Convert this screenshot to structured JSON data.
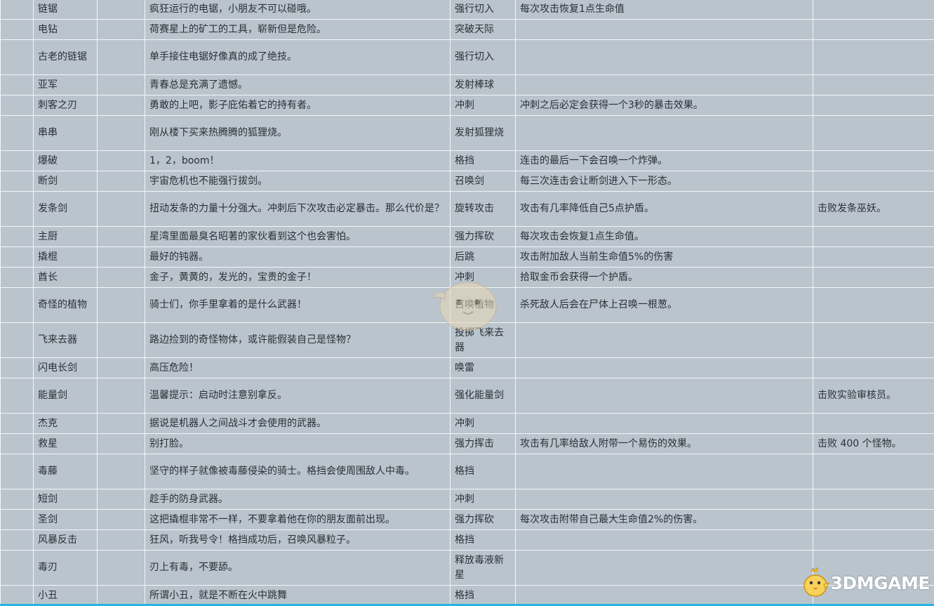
{
  "rows": [
    {
      "name": "链锯",
      "desc": "疯狂运行的电锯，小朋友不可以碰哦。",
      "skill": "强行切入",
      "effect": "每次攻击恢复1点生命值",
      "unlock": ""
    },
    {
      "name": "电钻",
      "desc": "荷赛星上的矿工的工具，崭新但是危险。",
      "skill": "突破天际",
      "effect": "",
      "unlock": ""
    },
    {
      "name": "古老的链锯",
      "desc": "单手接住电锯好像真的成了绝技。",
      "skill": "强行切入",
      "effect": "",
      "unlock": ""
    },
    {
      "name": "亚军",
      "desc": "青春总是充满了遗憾。",
      "skill": "发射棒球",
      "effect": "",
      "unlock": ""
    },
    {
      "name": "刺客之刃",
      "desc": "勇敢的上吧，影子庇佑着它的持有者。",
      "skill": "冲刺",
      "effect": "冲刺之后必定会获得一个3秒的暴击效果。",
      "unlock": ""
    },
    {
      "name": "串串",
      "desc": "刚从楼下买来热腾腾的狐狸烧。",
      "skill": "发射狐狸烧",
      "effect": "",
      "unlock": ""
    },
    {
      "name": "爆破",
      "desc": "1，2，boom！",
      "skill": "格挡",
      "effect": "连击的最后一下会召唤一个炸弹。",
      "unlock": ""
    },
    {
      "name": "断剑",
      "desc": "宇宙危机也不能强行拔剑。",
      "skill": "召唤剑",
      "effect": "每三次连击会让断剑进入下一形态。",
      "unlock": ""
    },
    {
      "name": "发条剑",
      "desc": "扭动发条的力量十分强大。冲刺后下次攻击必定暴击。那么代价是？",
      "skill": "旋转攻击",
      "effect": "攻击有几率降低自己5点护盾。",
      "unlock": "击败发条巫妖。"
    },
    {
      "name": "主厨",
      "desc": "星湾里面最臭名昭著的家伙看到这个也会害怕。",
      "skill": "强力挥砍",
      "effect": "每次攻击会恢复1点生命值。",
      "unlock": ""
    },
    {
      "name": "撬棍",
      "desc": "最好的钝器。",
      "skill": "后跳",
      "effect": "攻击附加敌人当前生命值5%的伤害",
      "unlock": ""
    },
    {
      "name": "酋长",
      "desc": "金子，黄黄的，发光的，宝贵的金子！",
      "skill": "冲刺",
      "effect": "拾取金币会获得一个护盾。",
      "unlock": ""
    },
    {
      "name": "奇怪的植物",
      "desc": "骑士们，你手里拿着的是什么武器！",
      "skill": "召唤植物",
      "effect": "杀死敌人后会在尸体上召唤一根葱。",
      "unlock": ""
    },
    {
      "name": "飞来去器",
      "desc": "路边捡到的奇怪物体，或许能假装自己是怪物？",
      "skill": "投掷飞来去器",
      "effect": "",
      "unlock": ""
    },
    {
      "name": "闪电长剑",
      "desc": "高压危险！",
      "skill": "唤雷",
      "effect": "",
      "unlock": ""
    },
    {
      "name": "能量剑",
      "desc": "温馨提示：启动时注意别拿反。",
      "skill": "强化能量剑",
      "effect": "",
      "unlock": "击败实验审核员。"
    },
    {
      "name": "杰克",
      "desc": "据说是机器人之间战斗才会使用的武器。",
      "skill": "冲刺",
      "effect": "",
      "unlock": ""
    },
    {
      "name": "救星",
      "desc": "别打脸。",
      "skill": "强力挥击",
      "effect": "攻击有几率给敌人附带一个易伤的效果。",
      "unlock": "击败 400 个怪物。"
    },
    {
      "name": "毒藤",
      "desc": "坚守的样子就像被毒藤侵染的骑士。格挡会使周围敌人中毒。",
      "skill": "格挡",
      "effect": "",
      "unlock": ""
    },
    {
      "name": "短剑",
      "desc": "趁手的防身武器。",
      "skill": "冲刺",
      "effect": "",
      "unlock": ""
    },
    {
      "name": "圣剑",
      "desc": "这把撬棍非常不一样，不要拿着他在你的朋友面前出现。",
      "skill": "强力挥砍",
      "effect": "每次攻击附带自己最大生命值2%的伤害。",
      "unlock": ""
    },
    {
      "name": "风暴反击",
      "desc": "狂风，听我号令！格挡成功后，召唤风暴粒子。",
      "skill": "格挡",
      "effect": "",
      "unlock": ""
    },
    {
      "name": "毒刃",
      "desc": "刃上有毒，不要舔。",
      "skill": "释放毒液新星",
      "effect": "",
      "unlock": ""
    },
    {
      "name": "小丑",
      "desc": "所谓小丑，就是不断在火中跳舞",
      "skill": "格挡",
      "effect": "",
      "unlock": ""
    }
  ],
  "watermark": {
    "brand": "3DMGAME",
    "icon": "chick-mascot-icon",
    "accent": "#29b3e2"
  }
}
